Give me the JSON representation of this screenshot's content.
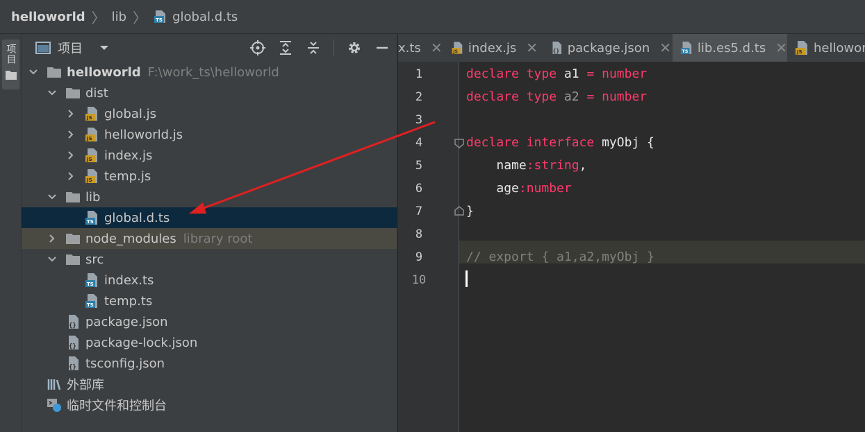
{
  "breadcrumb": {
    "project": "helloworld",
    "folder": "lib",
    "file": "global.d.ts"
  },
  "sidestripe": {
    "label": "项目"
  },
  "panel": {
    "title": "项目"
  },
  "tree": {
    "root_name": "helloworld",
    "root_path": "F:\\work_ts\\helloworld",
    "dist": "dist",
    "dist_files": [
      "global.js",
      "helloworld.js",
      "index.js",
      "temp.js"
    ],
    "lib": "lib",
    "lib_file": "global.d.ts",
    "node_modules": "node_modules",
    "node_modules_hint": "library root",
    "src": "src",
    "src_files": [
      "index.ts",
      "temp.ts"
    ],
    "root_files": [
      "package.json",
      "package-lock.json",
      "tsconfig.json"
    ],
    "external_libs": "外部库",
    "scratches": "临时文件和控制台"
  },
  "tabs": [
    "x.ts",
    "index.js",
    "package.json",
    "lib.es5.d.ts",
    "hellowor"
  ],
  "editor": {
    "line_numbers": [
      "1",
      "2",
      "3",
      "4",
      "5",
      "6",
      "7",
      "8",
      "9",
      "10"
    ],
    "current_line": 10,
    "code": {
      "l1_kw1": "declare",
      "l1_kw2": "type",
      "l1_id": "a1",
      "l1_eq": "=",
      "l1_type": "number",
      "l2_kw1": "declare",
      "l2_kw2": "type",
      "l2_id": "a2",
      "l2_eq": "=",
      "l2_type": "number",
      "l4_kw1": "declare",
      "l4_kw2": "interface",
      "l4_id": "myObj",
      "l4_brace": "{",
      "l5_prop": "name",
      "l5_type": ":string",
      "l5_comma": ",",
      "l6_prop": "age",
      "l6_type": ":number",
      "l7_brace": "}",
      "l9_comment": "// export { a1,a2,myObj }"
    }
  },
  "colors": {
    "keyword": "#ff3b6b",
    "selection": "#0d293e",
    "arrow": "#e02020"
  }
}
